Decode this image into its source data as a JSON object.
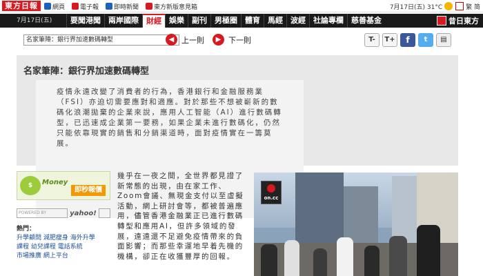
{
  "header": {
    "logo_text": "東方日報",
    "links": [
      {
        "label": "網頁"
      },
      {
        "label": "電子報"
      },
      {
        "label": "即時新聞"
      },
      {
        "label": "東方新版意見箱"
      }
    ],
    "date_weather": "7月17日(五) 31°C",
    "tools_text": "繁 简"
  },
  "nav": {
    "date": "7月17日(五)",
    "items": [
      "要聞港聞",
      "兩岸國際",
      "財經",
      "娛樂",
      "副刊",
      "男極圈",
      "體育",
      "馬經",
      "波經",
      "社論專欄",
      "慈善基金"
    ],
    "active": "財經",
    "right_label": "昔日東方"
  },
  "toolbar": {
    "select_value": "名家筆陣：銀行界加速數碼轉型",
    "prev_label": "上一則",
    "next_label": "下一則",
    "font_dec": "T-",
    "font_inc": "T+",
    "facebook": "f",
    "twitter": "t",
    "print": "▤"
  },
  "article": {
    "title": "名家筆陣：銀行界加速數碼轉型",
    "lead": "疫情永遠改變了消費者的行為，香港銀行和金融服務業（FSI）亦迫切需要應對和適應。對於那些不想被嶄新的數碼化浪潮拋棄的企業來說，應用人工智能（AI）進行數碼轉型，已迅速成企業第一要務，如果企業未進行數碼化，仍然只能依靠現實的銷售和分銷渠道時，面對疫情實在一籌莫展。",
    "body": "幾乎在一夜之間，全世界都見證了新常態的出現，由在家工作、Zoom會議、無現金支付以至虛擬活動，網上研討會等，都被普遍應用，儘管香港金融業正已進行數碼轉型和應用AI，但許多領域的發展，遠遠還不足避免疫情帶來的負面影響；而那些幸運地早着先機的機構，卻正在收獲豐厚的回報。"
  },
  "sidebar": {
    "money_brand": "Money",
    "money_button": "即秒報價",
    "search_powered": "POWERED BY",
    "yahoo": "yahoo!",
    "hot_label": "熱門：",
    "hot_links": [
      "升學顧問",
      "減肥瘦身",
      "海外升學",
      "課程",
      "幼兒課程",
      "電話系統",
      "市場推廣",
      "網上平台"
    ]
  },
  "photo": {
    "watermark": "on.cc"
  }
}
